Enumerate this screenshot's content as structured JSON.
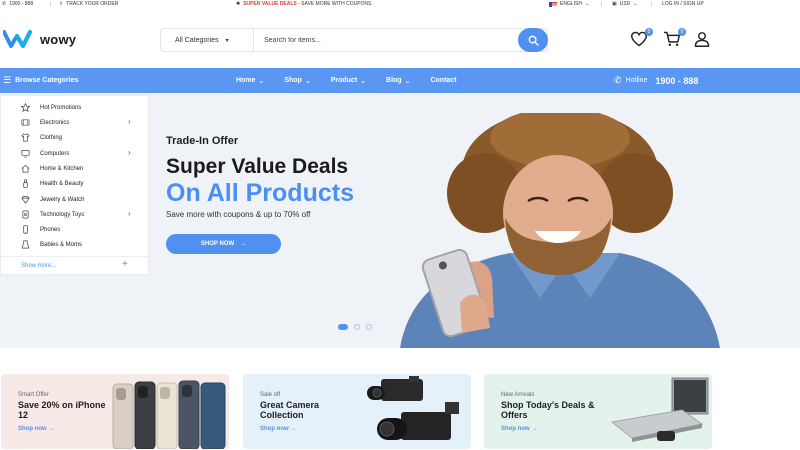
{
  "topbar": {
    "phone": "1900 - 888",
    "track": "TRACK YOUR ORDER",
    "promo_highlight": "SUPER VALUE DEALS",
    "promo_rest": " - SAVE MORE WITH COUPONS",
    "language": "ENGLISH",
    "currency": "USD",
    "account": "LOG IN / SIGN UP"
  },
  "header": {
    "logo_text": "wowy",
    "search_category": "All Categories",
    "search_placeholder": "Search for items...",
    "wishlist_count": "0",
    "cart_count": "0"
  },
  "nav": {
    "browse_label": "Browse Categories",
    "links": [
      "Home",
      "Shop",
      "Product",
      "Blog",
      "Contact"
    ],
    "hotline_label": "Hotline",
    "hotline_number": "1900 - 888"
  },
  "categories": {
    "items": [
      {
        "label": "Hot Promotions",
        "icon": "star-icon"
      },
      {
        "label": "Electronics",
        "icon": "grid-icon"
      },
      {
        "label": "Clothing",
        "icon": "shirt-icon"
      },
      {
        "label": "Computers",
        "icon": "monitor-icon"
      },
      {
        "label": "Home & Kitchen",
        "icon": "home-icon"
      },
      {
        "label": "Health & Beauty",
        "icon": "bottle-icon"
      },
      {
        "label": "Jewelry & Watch",
        "icon": "diamond-icon"
      },
      {
        "label": "Technology Toys",
        "icon": "gamepad-icon"
      },
      {
        "label": "Phones",
        "icon": "phone-icon"
      },
      {
        "label": "Babies & Moms",
        "icon": "baby-icon"
      }
    ],
    "show_more": "Show more..."
  },
  "hero": {
    "kicker": "Trade-In Offer",
    "title_line1": "Super Value Deals",
    "title_line2": "On All Products",
    "subtitle": "Save more with coupons & up to 70% off",
    "button": "SHOP NOW",
    "active_slide": 1
  },
  "cards": [
    {
      "kicker": "Smart Offer",
      "title": "Save 20% on iPhone 12",
      "link": "Shop now",
      "bg": "#f6e9e6"
    },
    {
      "kicker": "Sale off",
      "title": "Great Camera Collection",
      "link": "Shop now",
      "bg": "#e4f0fa"
    },
    {
      "kicker": "New Arrivals",
      "title": "Shop Today's Deals & Offers",
      "link": "Shop now",
      "bg": "#e4f2ec"
    }
  ],
  "colors": {
    "accent": "#4f90f0",
    "nav_bg": "#5a97f3",
    "hero_bg": "#eff2f7",
    "promo_red": "#e23c3c"
  }
}
